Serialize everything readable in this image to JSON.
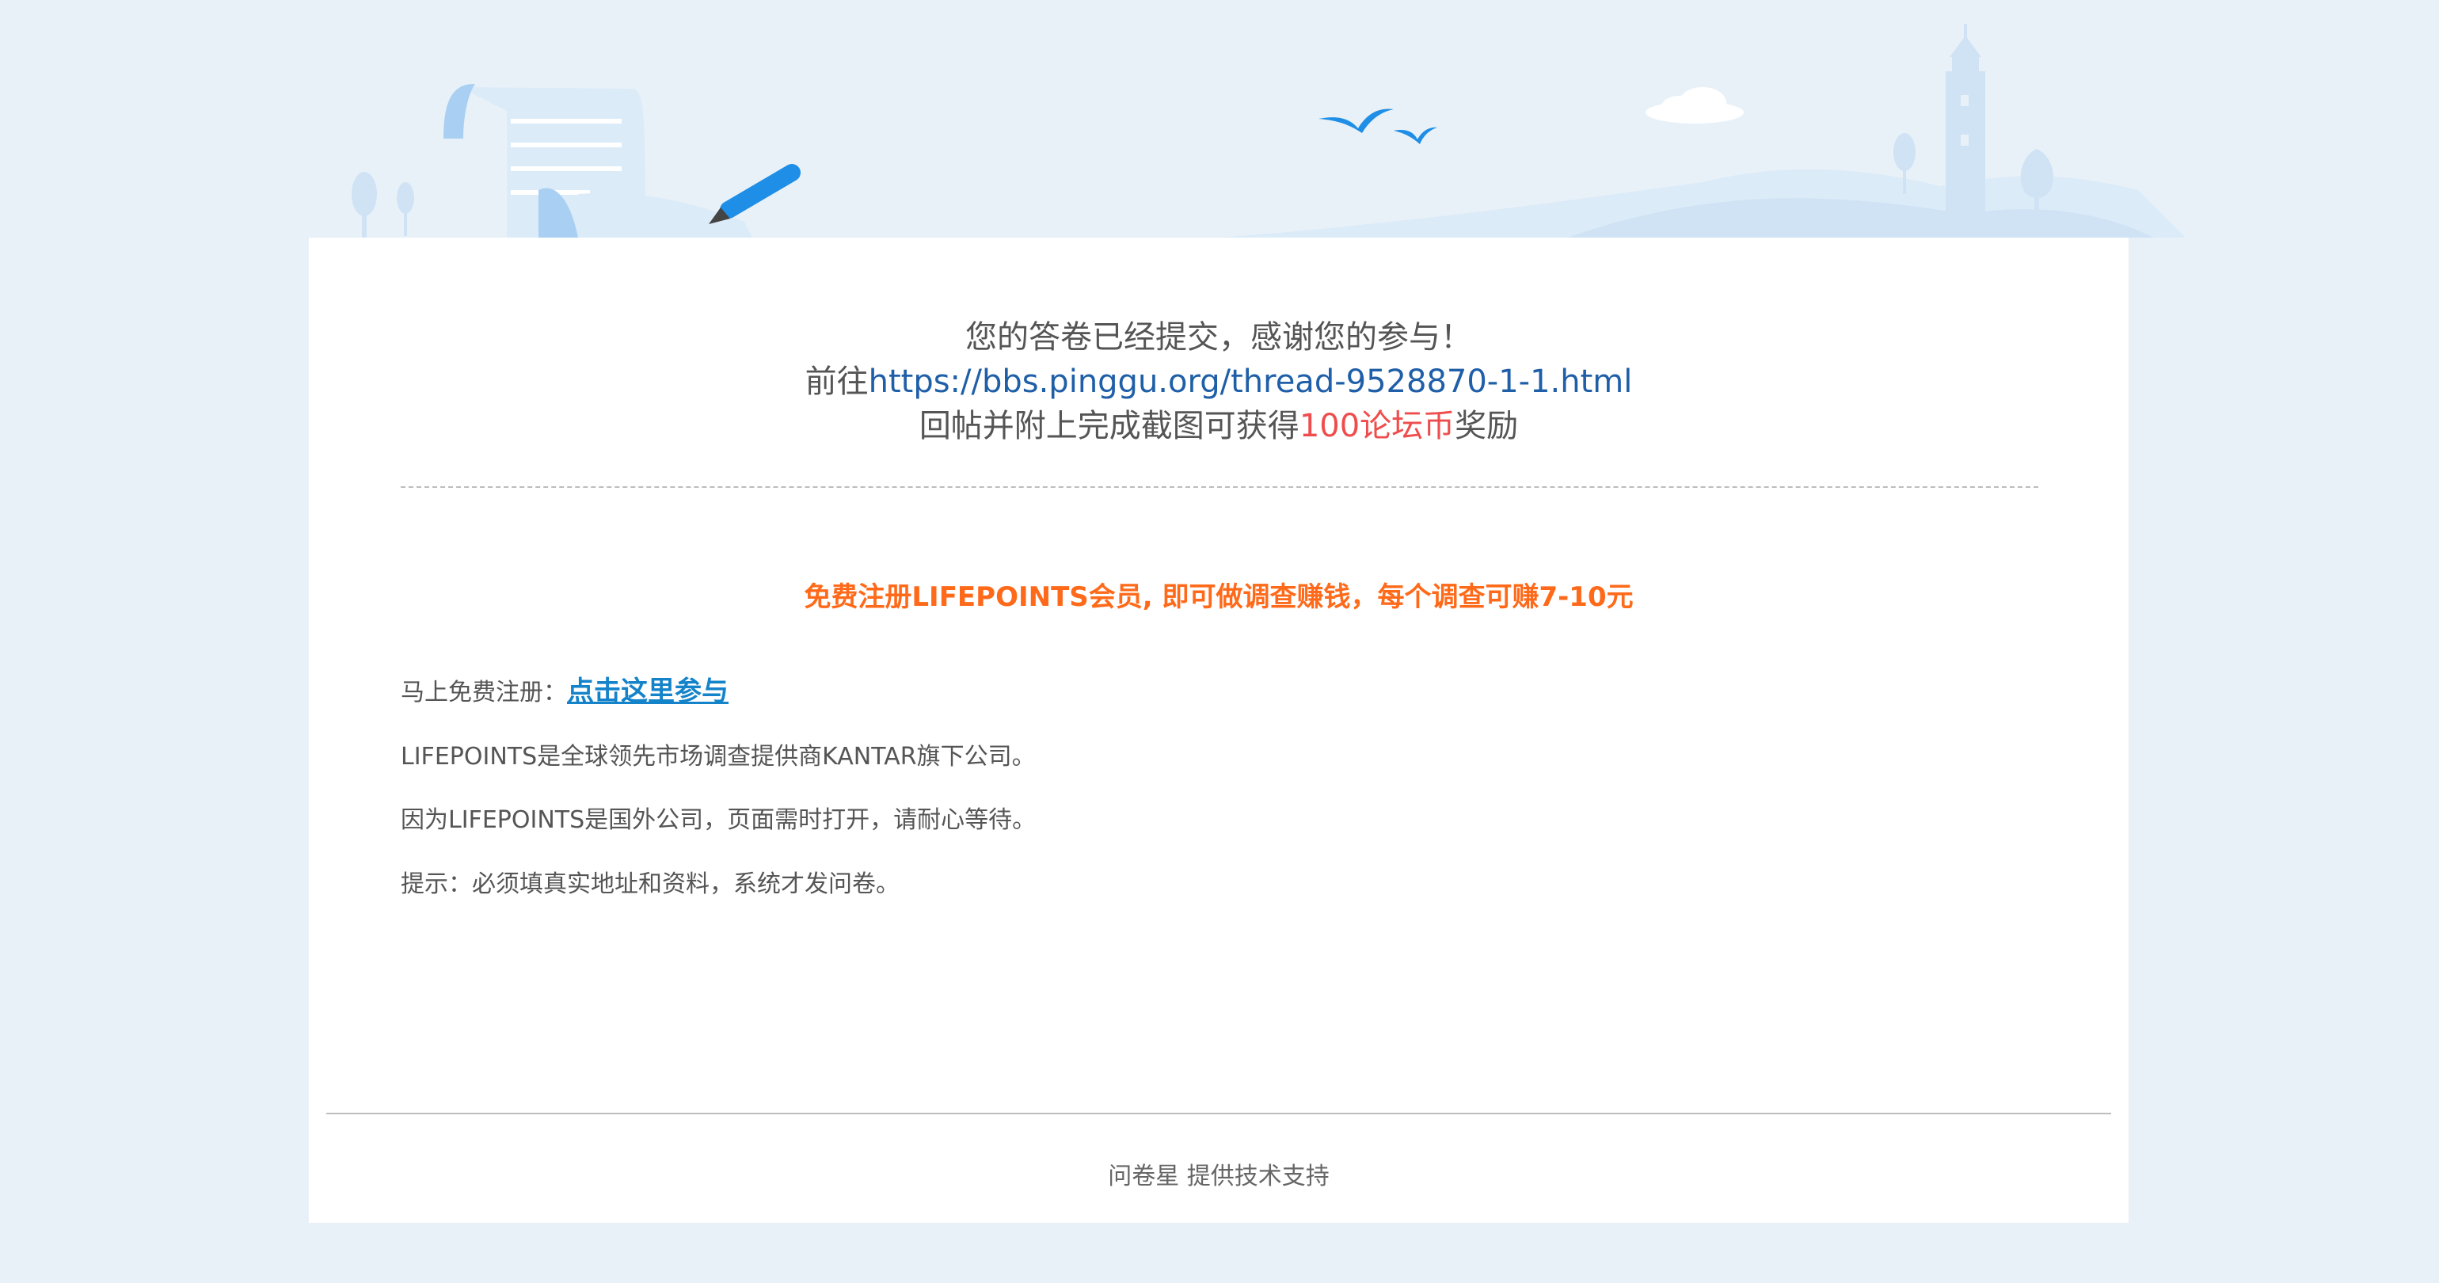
{
  "header": {
    "title_line": "您的答卷已经提交，感谢您的参与！",
    "goto_prefix": "前往",
    "thread_url": "https://bbs.pinggu.org/thread-9528870-1-1.html",
    "reward_prefix": "回帖并附上完成截图可获得",
    "reward_amount": "100论坛币",
    "reward_suffix": "奖励"
  },
  "promo": {
    "headline": "免费注册LIFEPOINTS会员, 即可做调查赚钱，每个调查可赚7-10元",
    "register_label": "马上免费注册：",
    "register_link": "点击这里参与",
    "line_company": "LIFEPOINTS是全球领先市场调查提供商KANTAR旗下公司。",
    "line_foreign": "因为LIFEPOINTS是国外公司，页面需时打开，请耐心等待。",
    "line_tip": "提示：必须填真实地址和资料，系统才发问卷。"
  },
  "footer": {
    "powered_by": "问卷星 提供技术支持"
  },
  "colors": {
    "background": "#e9f1f8",
    "card": "#ffffff",
    "link_blue": "#1f5fa8",
    "reward_red": "#ef4d4d",
    "promo_orange": "#ff6a1a",
    "join_link_blue": "#1583c9"
  }
}
